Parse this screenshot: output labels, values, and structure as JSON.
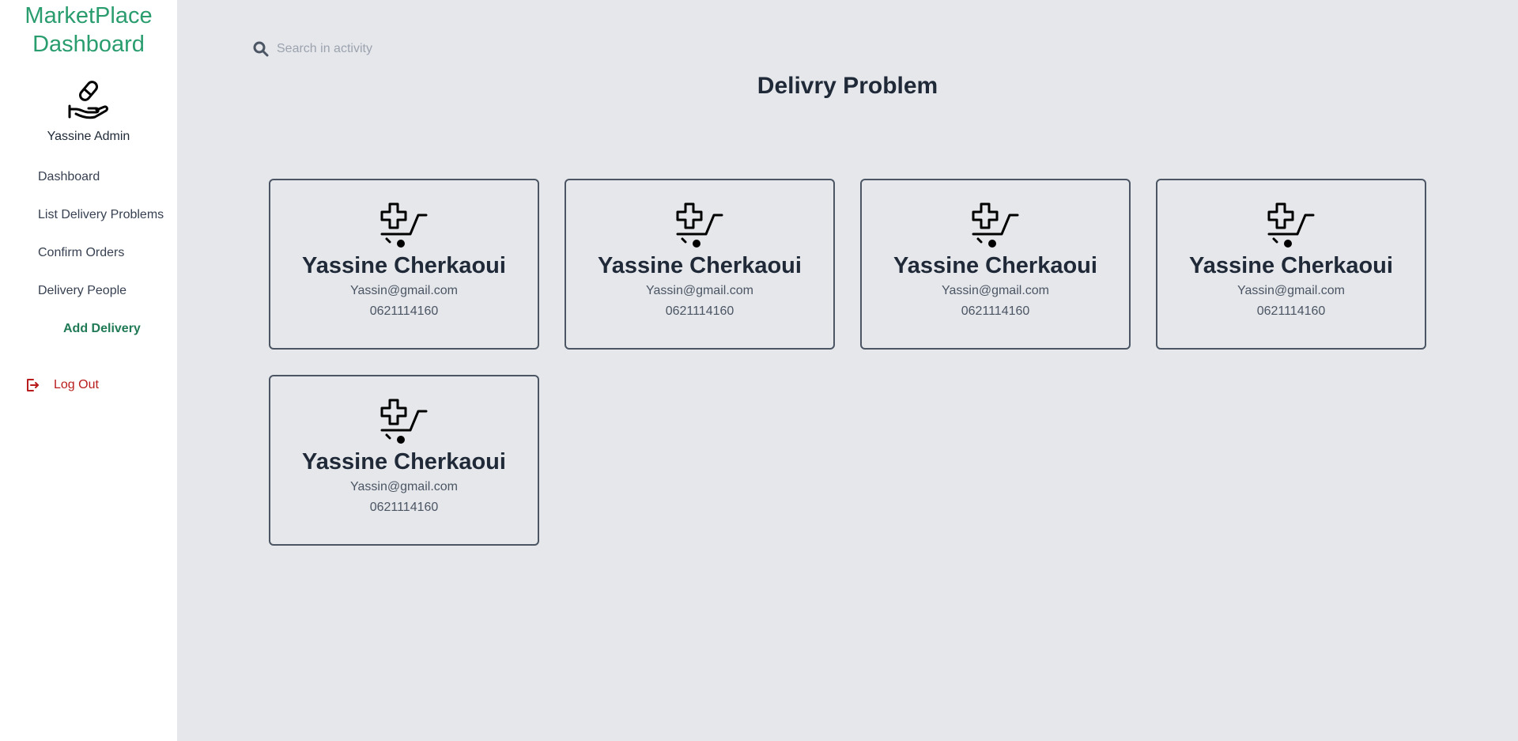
{
  "sidebar": {
    "brand_line1": "MarketPlace",
    "brand_line2": "Dashboard",
    "logo_icon": "hand-pill-icon",
    "admin_name": "Yassine Admin",
    "nav": [
      {
        "label": "Dashboard"
      },
      {
        "label": "List Delivery Problems"
      },
      {
        "label": "Confirm Orders"
      },
      {
        "label": "Delivery People"
      },
      {
        "label": "Add Delivery"
      }
    ],
    "logout_label": "Log Out"
  },
  "search": {
    "placeholder": "Search in activity"
  },
  "page_title": "Delivry Problem",
  "cards": [
    {
      "name": "Yassine Cherkaoui",
      "email": "Yassin@gmail.com",
      "phone": "0621114160"
    },
    {
      "name": "Yassine Cherkaoui",
      "email": "Yassin@gmail.com",
      "phone": "0621114160"
    },
    {
      "name": "Yassine Cherkaoui",
      "email": "Yassin@gmail.com",
      "phone": "0621114160"
    },
    {
      "name": "Yassine Cherkaoui",
      "email": "Yassin@gmail.com",
      "phone": "0621114160"
    },
    {
      "name": "Yassine Cherkaoui",
      "email": "Yassin@gmail.com",
      "phone": "0621114160"
    }
  ],
  "colors": {
    "brand": "#2a9d6f",
    "logout": "#b91c1c",
    "background": "#e5e7eb"
  }
}
